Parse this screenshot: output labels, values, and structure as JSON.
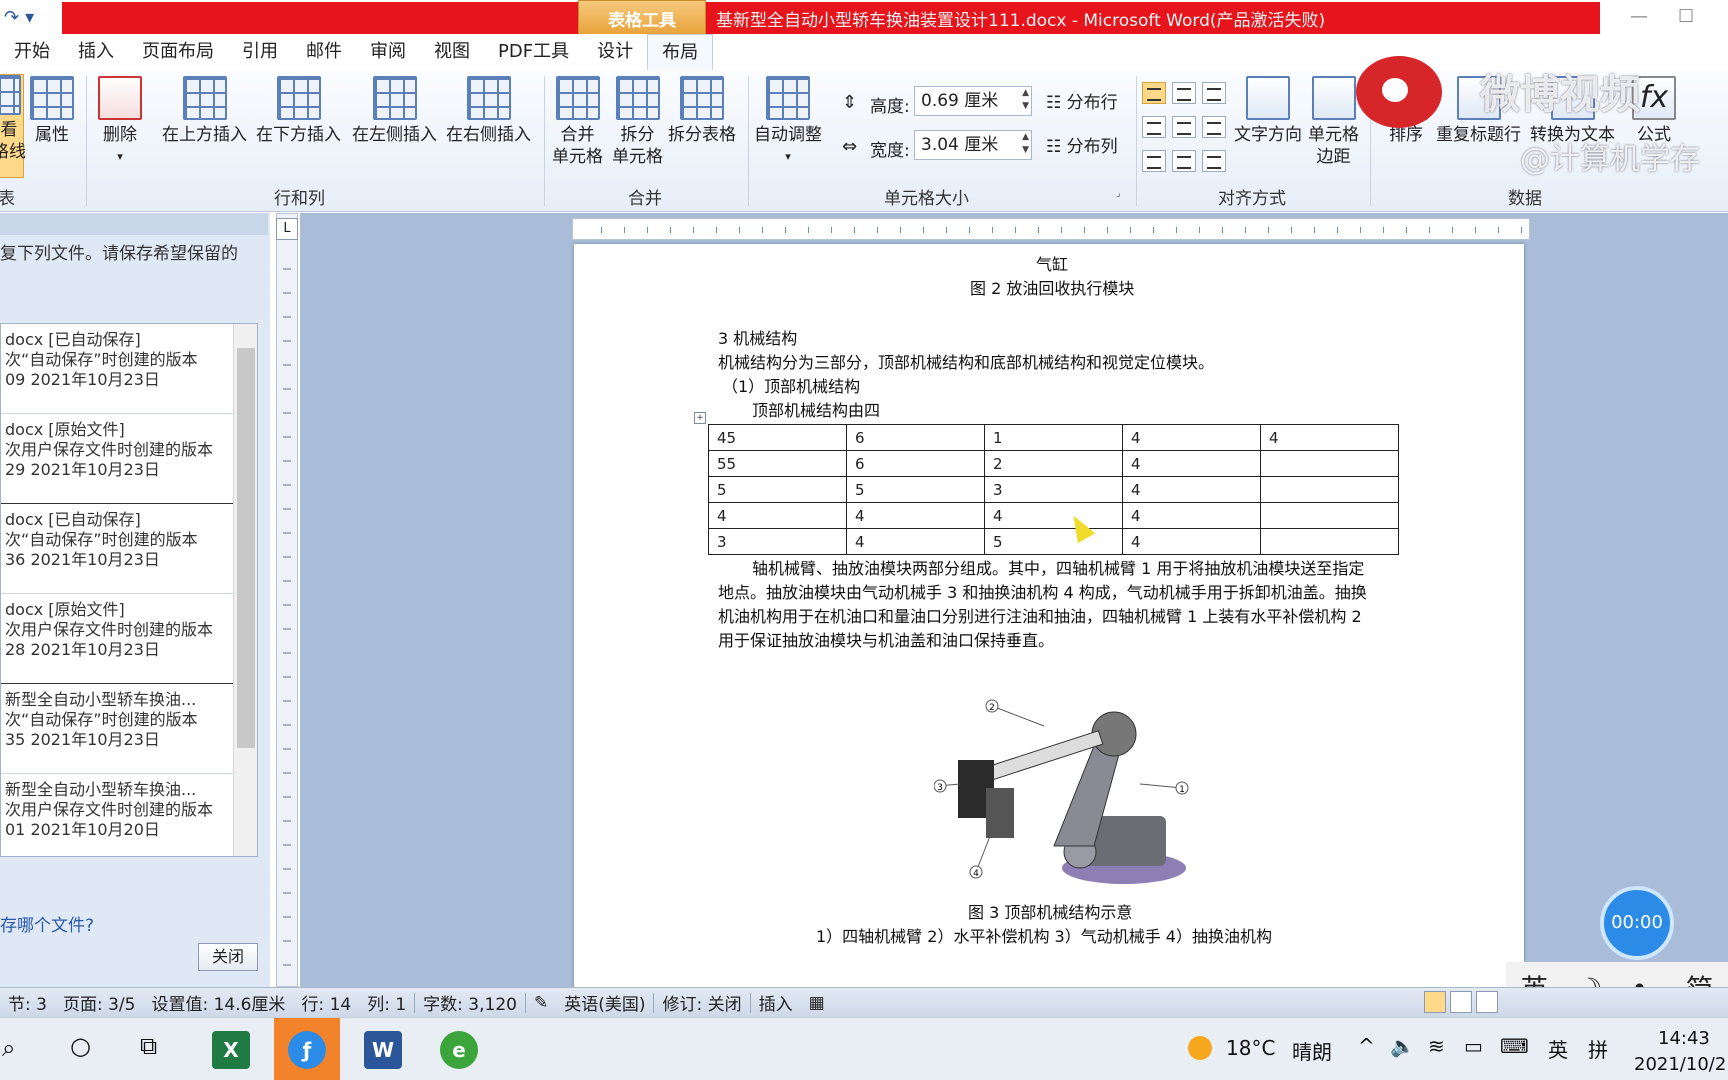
{
  "window": {
    "contextual_tab": "表格工具",
    "title": "基新型全自动小型轿车换油装置设计111.docx - Microsoft Word(产品激活失败)"
  },
  "qat": {
    "redo": "↷",
    "more": "▾"
  },
  "tabs": [
    "开始",
    "插入",
    "页面布局",
    "引用",
    "邮件",
    "审阅",
    "视图",
    "PDF工具",
    "设计",
    "布局"
  ],
  "ribbon": {
    "view_gridlines": "看",
    "view_gridlines_2": "格线",
    "properties": "属性",
    "delete": "删除",
    "insert_above": "在上方插入",
    "insert_below": "在下方插入",
    "insert_left": "在左侧插入",
    "insert_right": "在右侧插入",
    "merge_cells_1": "合并",
    "merge_cells_2": "单元格",
    "split_cells_1": "拆分",
    "split_cells_2": "单元格",
    "split_table": "拆分表格",
    "autofit": "自动调整",
    "height_label": "高度:",
    "height_value": "0.69 厘米",
    "width_label": "宽度:",
    "width_value": "3.04 厘米",
    "distribute_rows": "分布行",
    "distribute_cols": "分布列",
    "text_direction": "文字方向",
    "cell_margins_1": "单元格",
    "cell_margins_2": "边距",
    "sort": "排序",
    "repeat_header": "重复标题行",
    "convert_text": "转换为文本",
    "formula": "公式",
    "groups": {
      "table": "表",
      "rows_cols": "行和列",
      "merge": "合并",
      "cell_size": "单元格大小",
      "alignment": "对齐方式",
      "data": "数据"
    }
  },
  "watermark": {
    "title": "微博视频",
    "sub": "@计算机学存"
  },
  "left_pane": {
    "intro": "复下列文件。请保存希望保留的",
    "items": [
      {
        "l1": "docx  [已自动保存]",
        "l2": "次“自动保存”时创建的版本",
        "l3": "09  2021年10月23日"
      },
      {
        "l1": "docx  [原始文件]",
        "l2": "次用户保存文件时创建的版本",
        "l3": "29  2021年10月23日"
      },
      {
        "l1": "docx  [已自动保存]",
        "l2": "次“自动保存”时创建的版本",
        "l3": "36  2021年10月23日"
      },
      {
        "l1": "docx  [原始文件]",
        "l2": "次用户保存文件时创建的版本",
        "l3": "28  2021年10月23日"
      },
      {
        "l1": "新型全自动小型轿车换油...",
        "l2": "次“自动保存”时创建的版本",
        "l3": "35  2021年10月23日"
      },
      {
        "l1": "新型全自动小型轿车换油...",
        "l2": "次用户保存文件时创建的版本",
        "l3": "01  2021年10月20日"
      }
    ],
    "question": "存哪个文件?",
    "close": "关闭"
  },
  "ruler_corner": "L",
  "document": {
    "line_top": "气缸",
    "fig2_caption": "图 2 放油回收执行模块",
    "heading3": "3 机械结构",
    "para1": "机械结构分为三部分，顶部机械结构和底部机械结构和视觉定位模块。",
    "sub1": "（1）顶部机械结构",
    "para2_start": "顶部机械结构由四",
    "table": [
      [
        "45",
        "6",
        "1",
        "4",
        "4"
      ],
      [
        "55",
        "6",
        "2",
        "4",
        ""
      ],
      [
        "5",
        "5",
        "3",
        "4",
        ""
      ],
      [
        "4",
        "4",
        "4",
        "4",
        ""
      ],
      [
        "3",
        "4",
        "5",
        "4",
        ""
      ]
    ],
    "para3_l1": "轴机械臂、抽放油模块两部分组成。其中，四轴机械臂 1 用于将抽放机油模块送至指定",
    "para3_l2": "地点。抽放油模块由气动机械手 3 和抽换油机构 4 构成，气动机械手用于拆卸机油盖。抽换",
    "para3_l3": "机油机构用于在机油口和量油口分别进行注油和抽油，四轴机械臂 1 上装有水平补偿机构 2",
    "para3_l4": "用于保证抽放油模块与机油盖和油口保持垂直。",
    "fig3_caption": "图 3 顶部机械结构示意",
    "fig3_legend": "1）四轴机械臂 2）水平补偿机构 3）气动机械手 4）抽换油机构",
    "callouts": [
      "1",
      "2",
      "3",
      "4"
    ]
  },
  "timer": "00:00",
  "ime": {
    "lang": "英",
    "moon": "☽",
    "punct": "•,",
    "mode": "简"
  },
  "status": {
    "section": "节: 3",
    "page": "页面: 3/5",
    "position": "设置值: 14.6厘米",
    "line": "行: 14",
    "col": "列: 1",
    "words": "字数: 3,120",
    "lang": "英语(美国)",
    "track": "修订: 关闭",
    "mode": "插入"
  },
  "taskbar": {
    "weather_temp": "18°C",
    "weather_desc": "晴朗",
    "ime_lang": "英",
    "ime_mode": "拼",
    "time": "14:43",
    "date": "2021/10/2"
  },
  "colors": {
    "title_red": "#e8141c",
    "accent_orange": "#f3832a",
    "ribbon_blue": "#5b7fb8"
  }
}
